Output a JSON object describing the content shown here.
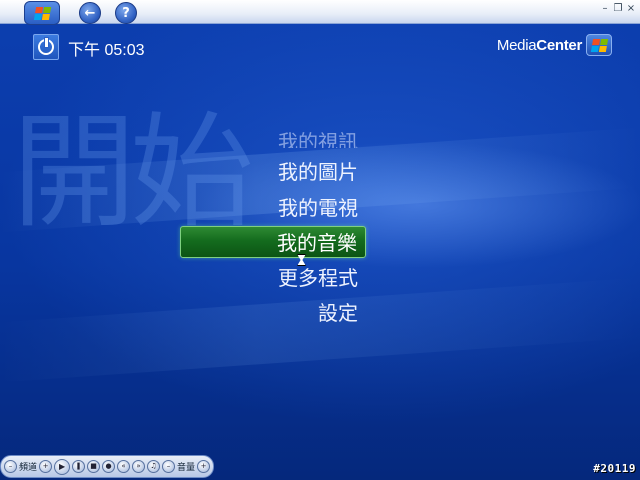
{
  "header": {
    "clock": "下午 05:03",
    "brand_light": "Media",
    "brand_bold": "Center"
  },
  "watermark": "開始",
  "menu": {
    "items": [
      {
        "label": "我的視訊",
        "state": "faded"
      },
      {
        "label": "我的圖片",
        "state": "normal"
      },
      {
        "label": "我的電視",
        "state": "normal"
      },
      {
        "label": "我的音樂",
        "state": "selected"
      },
      {
        "label": "更多程式",
        "state": "normal"
      },
      {
        "label": "設定",
        "state": "normal"
      }
    ]
  },
  "transport": {
    "channel_label": "頻道",
    "volume_label": "音量"
  },
  "build_tag": "#20119",
  "colors": {
    "background": "#0a3aa8",
    "selection": "#146c1e",
    "topbar": "#e8eef8"
  },
  "icons": {
    "start": "windows-flag-icon",
    "back": "back-arrow-icon",
    "help": "help-icon",
    "power": "power-icon"
  }
}
